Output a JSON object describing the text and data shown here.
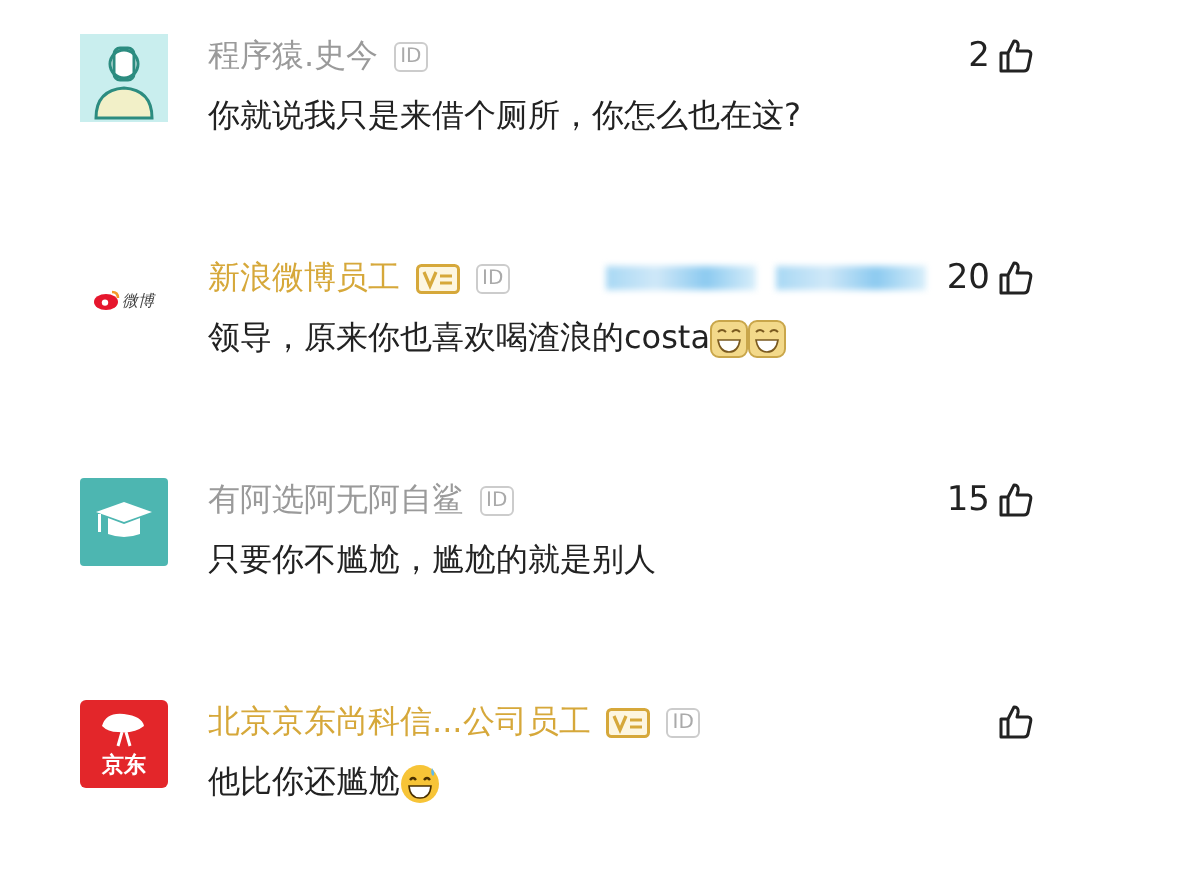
{
  "comments": [
    {
      "avatar": {
        "kind": "coder"
      },
      "name": "程序猿.史今",
      "verified": false,
      "id_badge": "ID",
      "likes": "2",
      "text": "你就说我只是来借个厕所，你怎么也在这?"
    },
    {
      "avatar": {
        "kind": "weibo",
        "label": "微博"
      },
      "name": "新浪微博员工",
      "verified": true,
      "id_badge": "ID",
      "redacted": true,
      "likes": "20",
      "text": "领导，原来你也喜欢喝渣浪的costa",
      "emojis": [
        {
          "kind": "grin"
        },
        {
          "kind": "grin"
        }
      ]
    },
    {
      "avatar": {
        "kind": "cap"
      },
      "name": "有阿选阿无阿自鲨",
      "verified": false,
      "id_badge": "ID",
      "likes": "15",
      "text": "只要你不尴尬，尴尬的就是别人"
    },
    {
      "avatar": {
        "kind": "jd",
        "label": "京东"
      },
      "name": "北京京东尚科信...公司员工",
      "verified": true,
      "id_badge": "ID",
      "text": "他比你还尴尬",
      "emojis": [
        {
          "kind": "sweat-smile"
        }
      ]
    }
  ]
}
